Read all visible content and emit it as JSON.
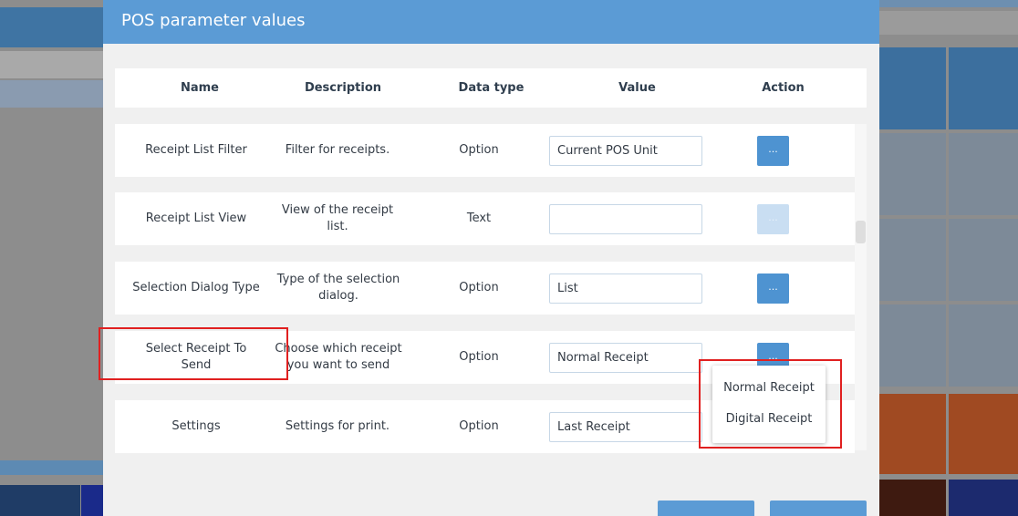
{
  "modal": {
    "title": "POS parameter values",
    "columns": [
      "Name",
      "Description",
      "Data type",
      "Value",
      "Action"
    ],
    "rows": [
      {
        "name": "Receipt List Filter",
        "description": "Filter for receipts.",
        "data_type": "Option",
        "value": "Current POS Unit",
        "action": "...",
        "action_enabled": true
      },
      {
        "name": "Receipt List View",
        "description": "View of the receipt list.",
        "data_type": "Text",
        "value": "",
        "action": "...",
        "action_enabled": false
      },
      {
        "name": "Selection Dialog Type",
        "description": "Type of the selection dialog.",
        "data_type": "Option",
        "value": "List",
        "action": "...",
        "action_enabled": true
      },
      {
        "name": "Select Receipt To Send",
        "description": "Choose which receipt you want to send",
        "data_type": "Option",
        "value": "Normal Receipt",
        "action": "...",
        "action_enabled": true
      },
      {
        "name": "Settings",
        "description": "Settings for print.",
        "data_type": "Option",
        "value": "Last Receipt",
        "action": "...",
        "action_enabled": true
      }
    ],
    "dropdown": {
      "options": [
        "Normal Receipt",
        "Digital Receipt"
      ]
    }
  },
  "colors": {
    "header": "#5b9bd5",
    "button": "#4e93d1",
    "highlight": "#e02020"
  }
}
